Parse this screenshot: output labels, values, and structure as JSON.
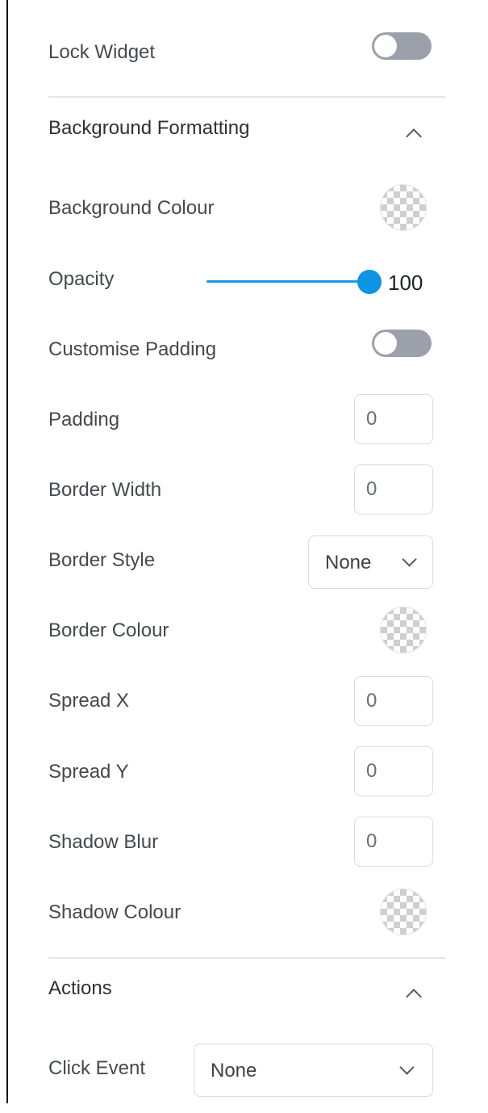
{
  "lock_widget": {
    "label": "Lock Widget",
    "enabled": false
  },
  "background_formatting": {
    "title": "Background Formatting",
    "expanded": true,
    "background_colour": {
      "label": "Background Colour",
      "value": "transparent"
    },
    "opacity": {
      "label": "Opacity",
      "value": "100",
      "fraction": 1.0
    },
    "customise_padding": {
      "label": "Customise Padding",
      "enabled": false
    },
    "padding": {
      "label": "Padding",
      "value": "0"
    },
    "border_width": {
      "label": "Border Width",
      "value": "0"
    },
    "border_style": {
      "label": "Border Style",
      "value": "None"
    },
    "border_colour": {
      "label": "Border Colour",
      "value": "transparent"
    },
    "spread_x": {
      "label": "Spread X",
      "value": "0"
    },
    "spread_y": {
      "label": "Spread Y",
      "value": "0"
    },
    "shadow_blur": {
      "label": "Shadow Blur",
      "value": "0"
    },
    "shadow_colour": {
      "label": "Shadow Colour",
      "value": "transparent"
    }
  },
  "actions": {
    "title": "Actions",
    "expanded": true,
    "click_event": {
      "label": "Click Event",
      "value": "None"
    }
  },
  "colors": {
    "accent": "#0f93e3",
    "toggle_off": "#9ca0aa",
    "divider": "#e6e6e6",
    "input_border": "#d9dbe0"
  },
  "icons": {
    "section_toggle": "chevron-up-icon",
    "select_arrow": "chevron-down-icon",
    "colour_swatch": "checkerboard-transparent-icon"
  }
}
